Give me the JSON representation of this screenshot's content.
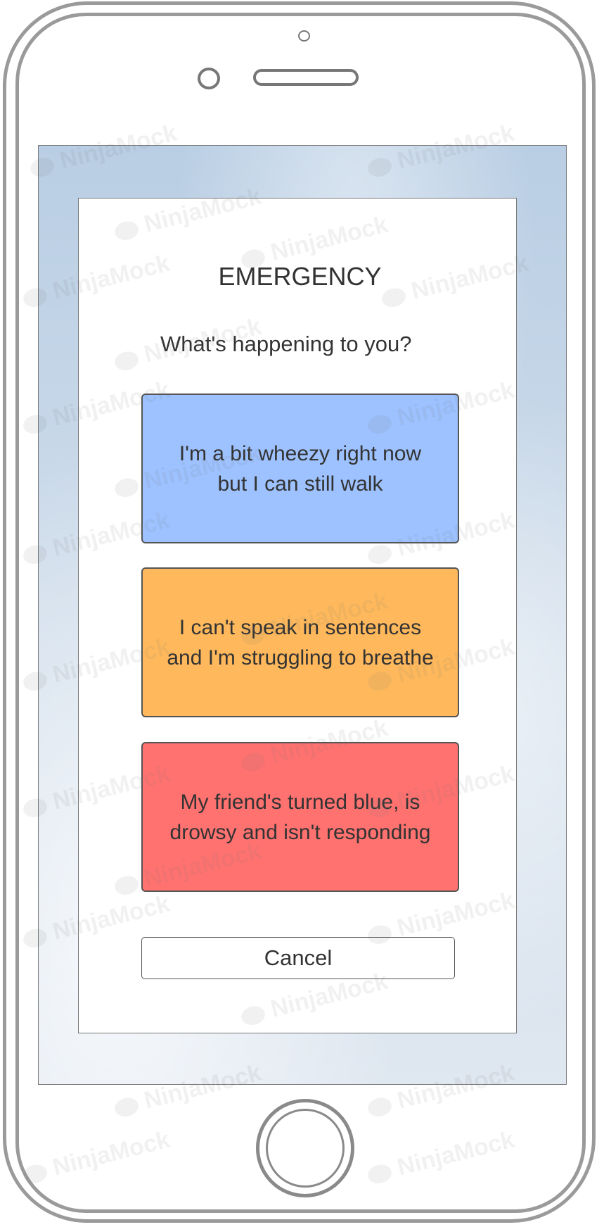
{
  "dialog": {
    "title": "EMERGENCY",
    "question": "What's happening to you?",
    "options": [
      {
        "label": "I'm a bit wheezy right now\nbut I can still walk",
        "color": "#9dc2ff"
      },
      {
        "label": "I can't speak in sentences\nand I'm struggling to breathe",
        "color": "#ffb95c"
      },
      {
        "label": "My friend's turned blue, is\ndrowsy and isn't responding",
        "color": "#ff7270"
      }
    ],
    "cancel_label": "Cancel"
  },
  "watermark": {
    "text": "NinjaMock"
  },
  "colors": {
    "screen_background": "#c8d8ea",
    "device_outline": "#9a9a9a"
  }
}
